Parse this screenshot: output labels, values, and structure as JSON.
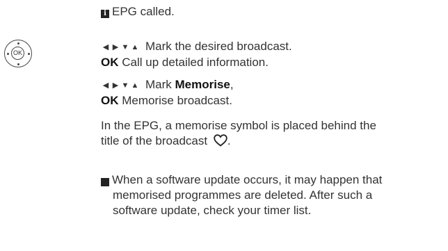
{
  "info_icon": "i",
  "step0": {
    "text": "EPG called."
  },
  "remote": {
    "label": "OK",
    "icon": "ok-button-navigation-ring-icon"
  },
  "step1": {
    "arrows": [
      "◀",
      "▶",
      "▼",
      "▲"
    ],
    "line1": "Mark the desired broadcast.",
    "ok": "OK",
    "line2": "Call up detailed information."
  },
  "step2": {
    "arrows": [
      "◀",
      "▶",
      "▼",
      "▲"
    ],
    "mark_prefix": "Mark",
    "memorise": "Memorise",
    "comma": ",",
    "ok": "OK",
    "line2": "Memorise broadcast."
  },
  "para": {
    "line1": "In the EPG, a memorise symbol is placed behind the",
    "line2": "title of the broadcast",
    "end": ".",
    "icon": "heart-outline-icon"
  },
  "note": {
    "line1": "When a software update occurs, it may happen that",
    "line2": "memorised programmes are deleted. After such a",
    "line3": "software update, check your timer list."
  }
}
